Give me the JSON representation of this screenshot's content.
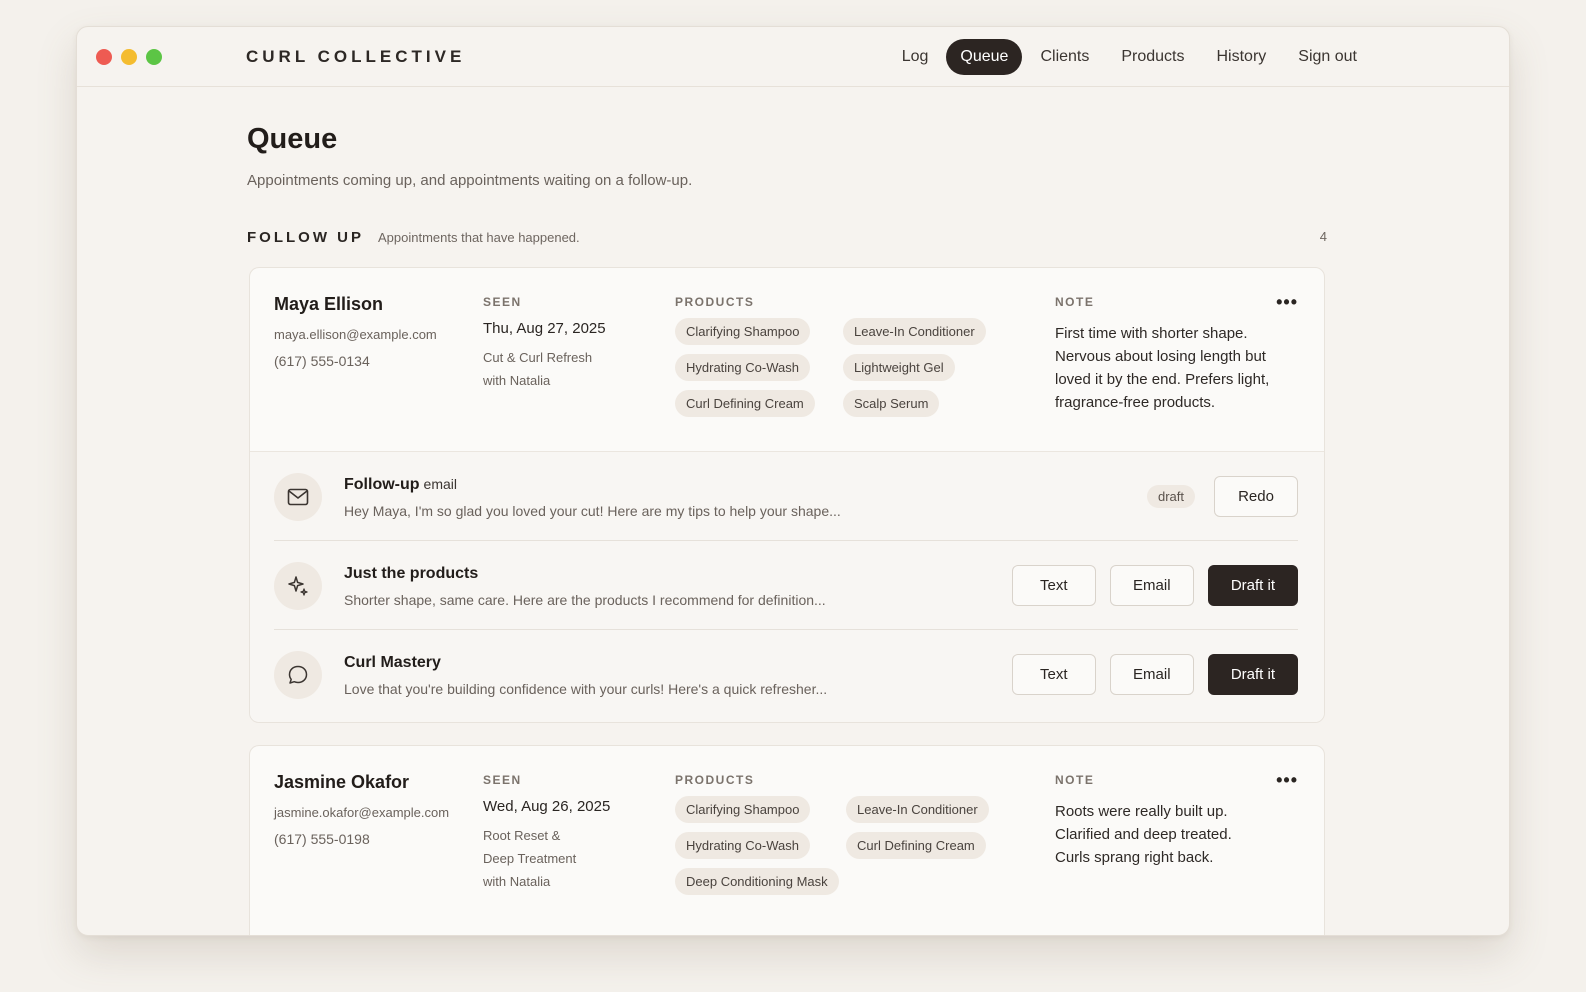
{
  "app": {
    "brand": "CURL COLLECTIVE",
    "nav": [
      {
        "label": "Log"
      },
      {
        "label": "Queue"
      },
      {
        "label": "Clients"
      },
      {
        "label": "Products"
      },
      {
        "label": "History"
      },
      {
        "label": "Sign out"
      }
    ],
    "active_nav": "Queue"
  },
  "page": {
    "title": "Queue",
    "subtitle": "Appointments coming up, and appointments waiting on a follow-up."
  },
  "section": {
    "title": "FOLLOW UP",
    "subtitle": "Appointments that have happened.",
    "count": "4"
  },
  "labels": {
    "seen": "SEEN",
    "products": "PRODUCTS",
    "note": "NOTE",
    "more": "•••"
  },
  "appointments": [
    {
      "name": "Maya Ellison",
      "email": "maya.ellison@example.com",
      "phone": "(617) 555-0134",
      "date": "Thu, Aug 27, 2025",
      "service": "Cut & Curl Refresh with Natalia",
      "products": [
        "Clarifying Shampoo",
        "Leave-In Conditioner",
        "Hydrating Co-Wash",
        "Lightweight Gel",
        "Curl Defining Cream",
        "Scalp Serum"
      ],
      "note": "First time with shorter shape. Nervous about losing length but loved it by the end. Prefers light, fragrance-free products.",
      "actions": [
        {
          "icon": "mail-icon",
          "title": "Follow-up",
          "kind": "email",
          "preview": "Hey Maya, I'm so glad you loved your cut! Here are my tips to help your shape...",
          "badge": "draft",
          "redo_label": "Redo"
        },
        {
          "icon": "sparkle-icon",
          "title": "Just the products",
          "preview": "Shorter shape, same care. Here are the products I recommend for definition...",
          "text_label": "Text",
          "email_label": "Email",
          "draft_label": "Draft it"
        },
        {
          "icon": "chat-bubble-icon",
          "title": "Curl Mastery",
          "preview": "Love that you're building confidence with your curls! Here's a quick refresher...",
          "text_label": "Text",
          "email_label": "Email",
          "draft_label": "Draft it"
        }
      ]
    },
    {
      "name": "Jasmine Okafor",
      "email": "jasmine.okafor@example.com",
      "phone": "(617) 555-0198",
      "date": "Wed, Aug 26, 2025",
      "service": "Root Reset & Deep Treatment with Natalia",
      "products": [
        "Clarifying Shampoo",
        "Leave-In Conditioner",
        "Hydrating Co-Wash",
        "Curl Defining Cream",
        "Deep Conditioning Mask"
      ],
      "note": "Roots were really built up. Clarified and deep treated. Curls sprang right back."
    }
  ]
}
